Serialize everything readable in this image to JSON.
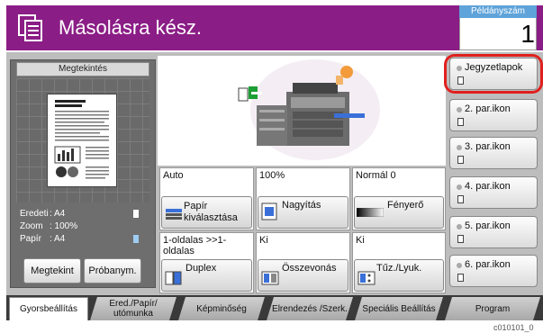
{
  "header": {
    "title": "Másolásra kész.",
    "copies_label": "Példányszám",
    "copies_value": "1"
  },
  "preview": {
    "heading": "Megtekintés",
    "original_label": "Eredeti",
    "original_value": ": A4",
    "zoom_label": "Zoom",
    "zoom_value": ": 100%",
    "paper_label": "Papír",
    "paper_value": ": A4",
    "btn_preview": "Megtekint",
    "btn_test": "Próbanym."
  },
  "settings": {
    "paper_value": "Auto",
    "paper_btn": "Papír kiválasztása",
    "zoom_value": "100%",
    "zoom_btn": "Nagyítás",
    "density_value": "Normál 0",
    "density_btn": "Fényerő",
    "duplex_value": "1-oldalas >>1-oldalas",
    "duplex_btn": "Duplex",
    "combine_value": "Ki",
    "combine_btn": "Összevonás",
    "staple_value": "Ki",
    "staple_btn": "Tűz./Lyuk."
  },
  "shortcuts": [
    "Jegyzetlapok",
    "2. par.ikon",
    "3. par.ikon",
    "4. par.ikon",
    "5. par.ikon",
    "6. par.ikon"
  ],
  "tabs": [
    "Gyorsbeállítás",
    "Ered./Papír/ utómunka",
    "Képminőség",
    "Elrendezés /Szerk.",
    "Speciális Beállítás",
    "Program"
  ],
  "footer_code": "c010101_0",
  "colors": {
    "header_bg": "#8b1d86",
    "copies_label_bg": "#5ea3d9",
    "highlight": "#e0201e"
  }
}
